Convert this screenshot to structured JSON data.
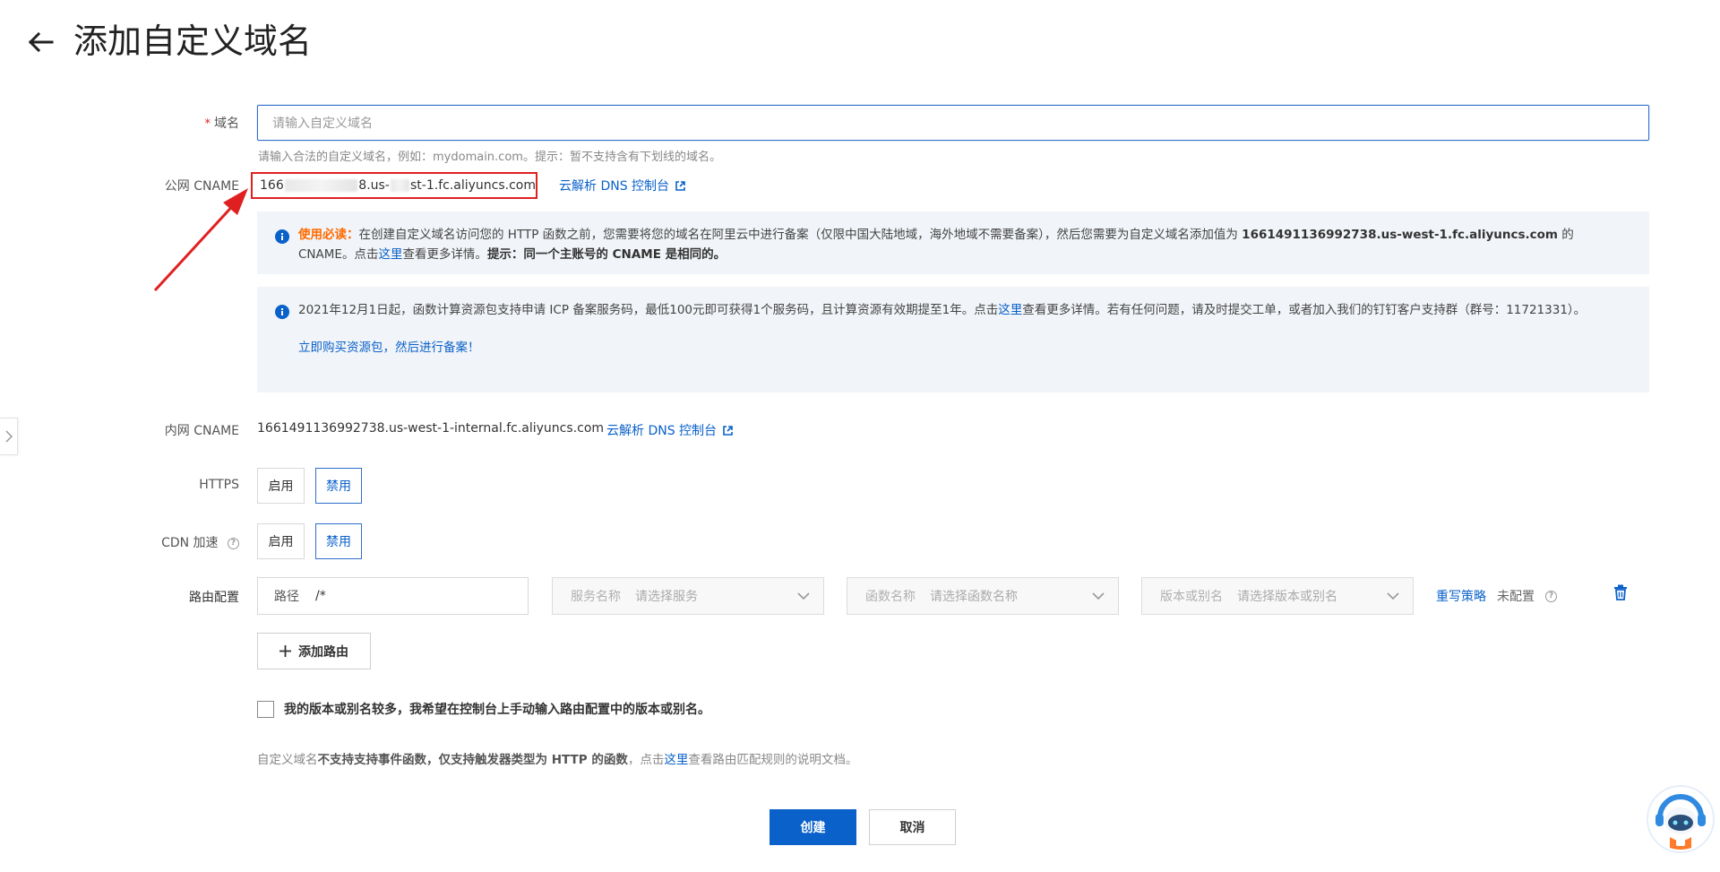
{
  "header": {
    "title": "添加自定义域名"
  },
  "domain": {
    "required_mark": "*",
    "label": "域名",
    "placeholder": "请输入自定义域名",
    "hint": "请输入合法的自定义域名，例如：mydomain.com。提示：暂不支持含有下划线的域名。"
  },
  "public_cname": {
    "label": "公网 CNAME",
    "value_prefix": "166",
    "value_mid": "8.us-",
    "value_suffix": "st-1.fc.aliyuncs.com",
    "dns_link": "云解析 DNS 控制台"
  },
  "notice1": {
    "warn_label": "使用必读：",
    "text_a": "在创建自定义域名访问您的 HTTP 函数之前，您需要将您的域名在阿里云中进行备案（仅限中国大陆地域，海外地域不需要备案），然后您需要为自定义域名添加值为 ",
    "cname_bold": "1661491136992738.us-west-1.fc.aliyuncs.com",
    "text_b": " 的 CNAME。点击",
    "link": "这里",
    "text_c": "查看更多详情。",
    "tip_bold": "提示：同一个主账号的 CNAME 是相同的。"
  },
  "notice2": {
    "text_a": "2021年12月1日起，函数计算资源包支持申请 ICP 备案服务码，最低100元即可获得1个服务码，且计算资源有效期提至1年。点击",
    "link": "这里",
    "text_b": "查看更多详情。若有任何问题，请及时提交工单，或者加入我们的钉钉客户支持群（群号：11721331）。",
    "buy_link": "立即购买资源包，然后进行备案！"
  },
  "internal_cname": {
    "label": "内网 CNAME",
    "value": "1661491136992738.us-west-1-internal.fc.aliyuncs.com",
    "dns_link": "云解析 DNS 控制台"
  },
  "https": {
    "label": "HTTPS",
    "enable": "启用",
    "disable": "禁用",
    "selected": "禁用"
  },
  "cdn": {
    "label": "CDN 加速",
    "enable": "启用",
    "disable": "禁用",
    "selected": "禁用"
  },
  "route": {
    "label": "路由配置",
    "path_label": "路径",
    "path_value": "/*",
    "service_label": "服务名称",
    "service_placeholder": "请选择服务",
    "function_label": "函数名称",
    "function_placeholder": "请选择函数名称",
    "version_label": "版本或别名",
    "version_placeholder": "请选择版本或别名",
    "rewrite_link": "重写策略",
    "rewrite_status": "未配置",
    "add_button": "添加路由"
  },
  "manual_checkbox": {
    "label": "我的版本或别名较多，我希望在控制台上手动输入路由配置中的版本或别名。"
  },
  "footer_note": {
    "text_a": "自定义域名",
    "bold": "不支持支持事件函数，仅支持触发器类型为 HTTP 的函数",
    "text_b": "，点击",
    "link": "这里",
    "text_c": "查看路由匹配规则的说明文档。"
  },
  "actions": {
    "create": "创建",
    "cancel": "取消"
  },
  "colors": {
    "primary": "#0a61c9",
    "warning": "#ff6a00",
    "highlight_border": "#e02020",
    "notice_bg": "#f1f4f8"
  }
}
